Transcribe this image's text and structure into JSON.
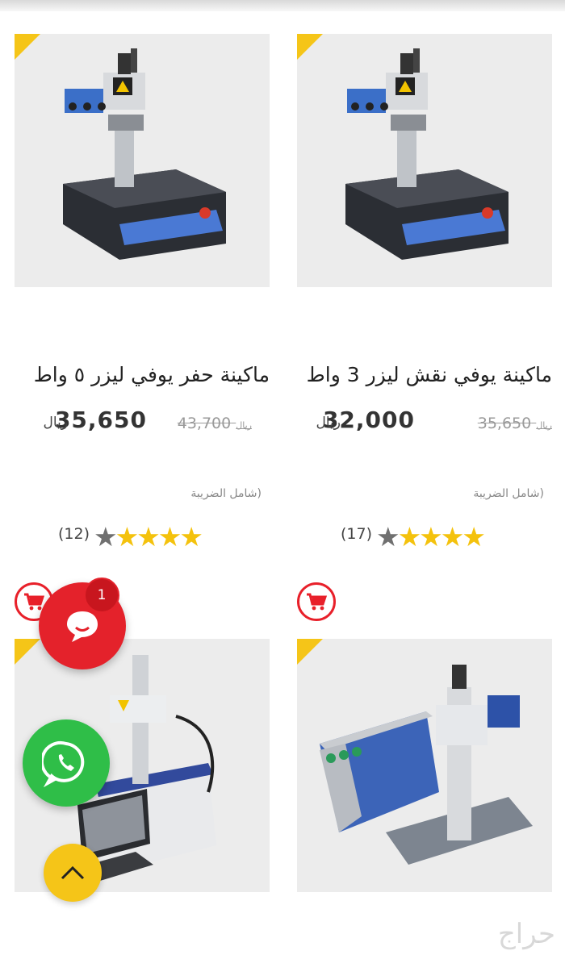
{
  "products": [
    {
      "title": "ماكينة يوفي نقش ليزر 3 واط",
      "new_price": "32,000",
      "old_price": "35,650",
      "currency": "ريال",
      "tax_note": "(شامل الضريبة",
      "rating": 4.5,
      "review_count": "(17)"
    },
    {
      "title": "ماكينة حفر يوفي ليزر ٥ واط",
      "new_price": "35,650",
      "old_price": "43,700",
      "currency": "ريال",
      "tax_note": "(شامل الضريبة",
      "rating": 4.5,
      "review_count": "(12)"
    }
  ],
  "fabs": {
    "chat_badge": "1",
    "chat_icon": "chat-bubble-icon",
    "whatsapp_icon": "whatsapp-icon",
    "scroll_icon": "chevron-up-icon"
  },
  "watermark": "حراج",
  "colors": {
    "accent_red": "#e4222b",
    "star_yellow": "#f4c20d",
    "corner_yellow": "#f5c518",
    "whatsapp_green": "#2fbe48"
  }
}
